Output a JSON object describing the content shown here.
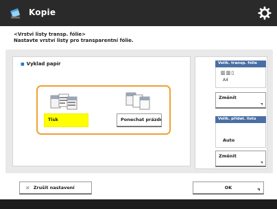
{
  "window": {
    "title": "Kopie",
    "app_icon": "copy-icon",
    "settings_icon": "gear-icon"
  },
  "header": {
    "line1": "<Vrstvi listy transp. fólie>",
    "line2": "Nastavte vrství listy pro transparentní fólie."
  },
  "left_panel": {
    "section_label": "Vyklad papír",
    "options": [
      {
        "label": "Tisk",
        "icon": "printed-sheets-icon",
        "selected": true
      },
      {
        "label": "Ponechat prázdné",
        "icon": "blank-sheets-icon",
        "selected": false
      }
    ]
  },
  "right_panel": {
    "size_info": {
      "heading": "Velik. transp. fólie",
      "icons": "▥▥▯",
      "value": "A4",
      "change_label": "Změnit"
    },
    "paper_info": {
      "heading": "Velik. přídat. listu",
      "value": "Auto",
      "change_label": "Změnit"
    }
  },
  "footer": {
    "close_label": "Zrušit nastavení",
    "ok_label": "OK"
  },
  "colors": {
    "accent_frame": "#f0a030",
    "selected_bg": "#ffff00",
    "info_header": "#4a6fa4"
  }
}
